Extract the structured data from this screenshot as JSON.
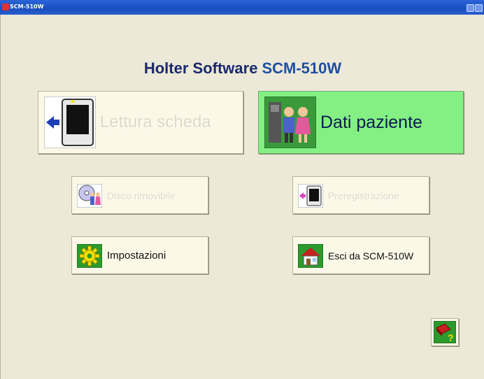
{
  "window": {
    "title": "SCM-510W"
  },
  "heading": {
    "part1": "Holter Software",
    "part2": "SCM-510W"
  },
  "buttons": {
    "read_card": "Lettura scheda",
    "patient_data": "Dati paziente",
    "removable_disk": "Disco rimovibile",
    "prerecording": "Preregistrazione",
    "settings": "Impostazioni",
    "exit": "Esci da SCM-510W"
  },
  "icons": {
    "read_card": "card-arrow-icon",
    "patient_data": "patients-icon",
    "removable_disk": "disc-people-icon",
    "prerecording": "card-small-icon",
    "settings": "gear-icon",
    "exit": "house-icon",
    "help": "help-book-icon"
  }
}
